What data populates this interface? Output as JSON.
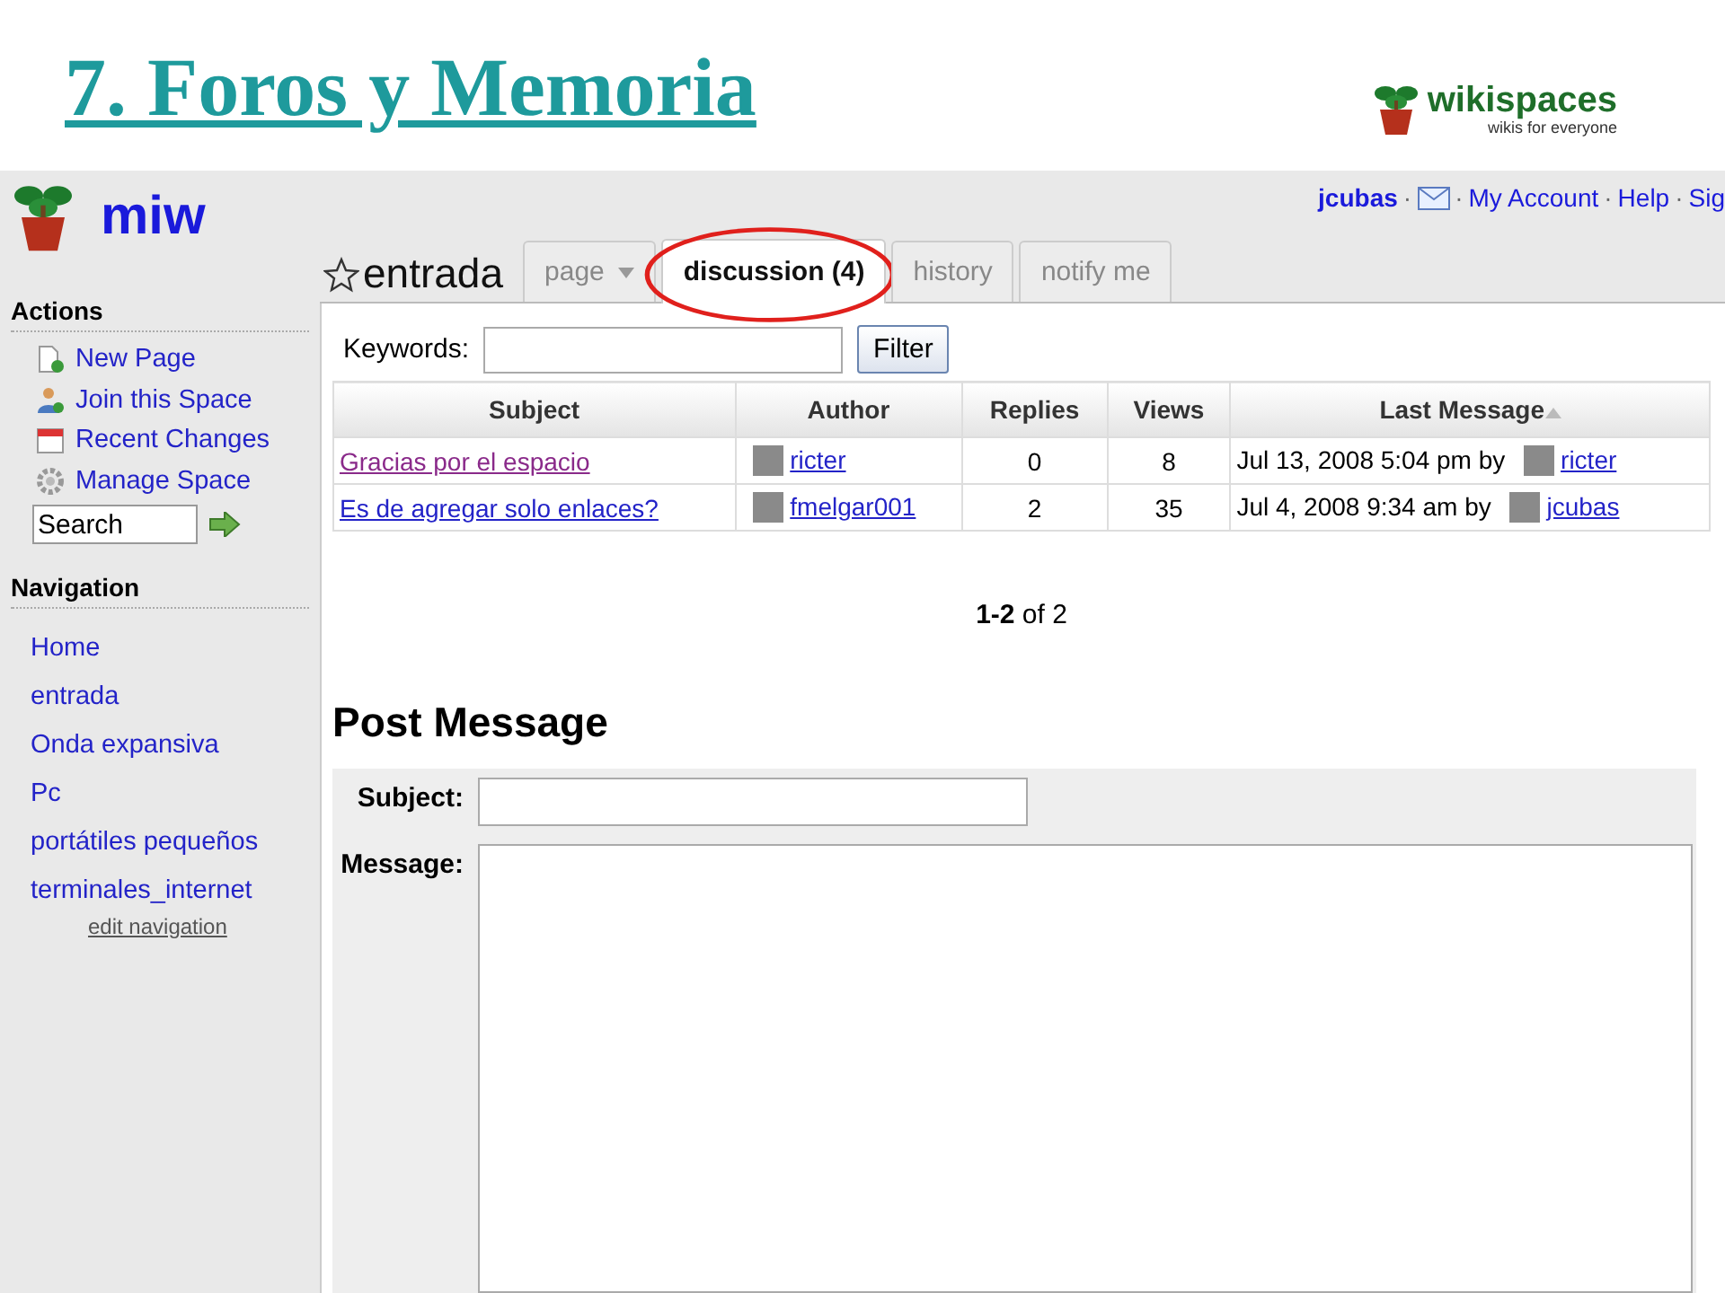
{
  "slide": {
    "title": "7. Foros y Memoria",
    "logo": {
      "name": "wikispaces",
      "tagline": "wikis for everyone"
    }
  },
  "sidebar": {
    "space_name": "miw",
    "actions_heading": "Actions",
    "actions": [
      {
        "label": "New Page",
        "kind": "page"
      },
      {
        "label": "Join this Space",
        "kind": "user"
      },
      {
        "label": "Recent Changes",
        "kind": "calendar"
      },
      {
        "label": "Manage Space",
        "kind": "gear"
      }
    ],
    "search": {
      "value": "Search"
    },
    "navigation_heading": "Navigation",
    "navigation": [
      "Home",
      "entrada",
      "Onda expansiva",
      "Pc",
      "portátiles pequeños",
      "terminales_internet"
    ],
    "edit_link": "edit navigation"
  },
  "user_bar": {
    "user": "jcubas",
    "separator": "·",
    "links": [
      "My Account",
      "Help",
      "Sig"
    ]
  },
  "page_title": "entrada",
  "tabs": [
    {
      "label": "page",
      "dropdown": true,
      "selected": false,
      "highlighted": false
    },
    {
      "label": "discussion (4)",
      "dropdown": false,
      "selected": true,
      "highlighted": true
    },
    {
      "label": "history",
      "dropdown": false,
      "selected": false,
      "highlighted": false
    },
    {
      "label": "notify me",
      "dropdown": false,
      "selected": false,
      "highlighted": false
    }
  ],
  "filter": {
    "label": "Keywords:",
    "button": "Filter"
  },
  "table": {
    "columns": [
      {
        "label": "Subject",
        "sorted": false
      },
      {
        "label": "Author",
        "sorted": false
      },
      {
        "label": "Replies",
        "sorted": false
      },
      {
        "label": "Views",
        "sorted": false
      },
      {
        "label": "Last Message",
        "sorted": true
      }
    ],
    "rows": [
      {
        "subject": "Gracias por el espacio",
        "visited": true,
        "author": "ricter",
        "replies": "0",
        "views": "8",
        "last_message": "Jul 13, 2008 5:04 pm by",
        "last_author": "ricter"
      },
      {
        "subject": "Es de agregar solo enlaces?",
        "visited": false,
        "author": "fmelgar001",
        "replies": "2",
        "views": "35",
        "last_message": "Jul 4, 2008 9:34 am by",
        "last_author": "jcubas"
      }
    ]
  },
  "pagination": "**1-2** of 2",
  "post_message": {
    "heading": "Post Message",
    "subject_label": "Subject:",
    "message_label": "Message:"
  }
}
